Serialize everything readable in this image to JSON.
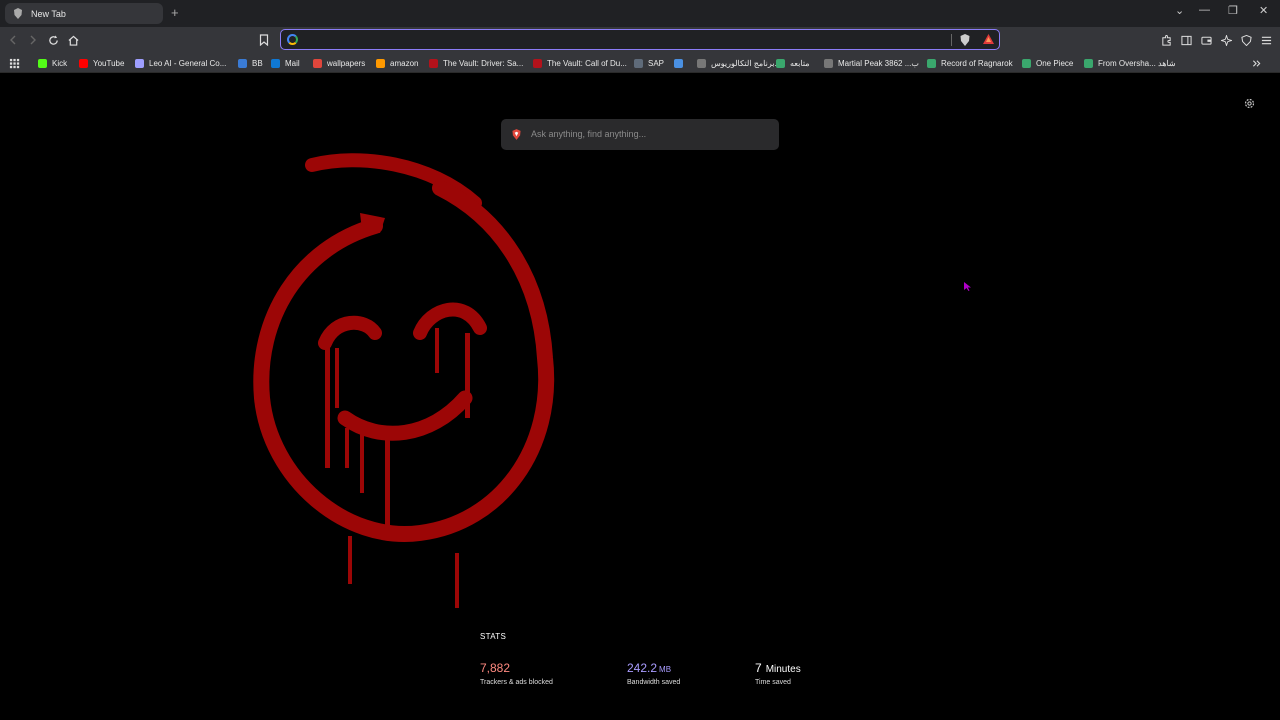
{
  "tab": {
    "title": "New Tab",
    "new_tab_symbol": "+"
  },
  "window_controls": {
    "dropdown": "⌄",
    "minimize": "—",
    "maximize": "❐",
    "close": "✕"
  },
  "toolbar": {
    "url_value": ""
  },
  "bookmarks": [
    {
      "label": "Kick",
      "color": "#53fc18"
    },
    {
      "label": "YouTube",
      "color": "#ff0000"
    },
    {
      "label": "Leo AI - General Co...",
      "color": "#9e9eff"
    },
    {
      "label": "BB",
      "color": "#3a7bd5"
    },
    {
      "label": "Mail",
      "color": "#0f78d4"
    },
    {
      "label": "wallpapers",
      "color": "#e0463c"
    },
    {
      "label": "amazon",
      "color": "#ff9900"
    },
    {
      "label": "The Vault: Driver: Sa...",
      "color": "#b3121b"
    },
    {
      "label": "The Vault: Call of Du...",
      "color": "#b3121b"
    },
    {
      "label": "SAP",
      "color": "#5f6b7a"
    },
    {
      "label": "",
      "color": "#4a90e2"
    },
    {
      "label": "برنامج التكالوريوس...",
      "color": "#777777"
    },
    {
      "label": "متابعه",
      "color": "#3aa76d"
    },
    {
      "label": "Martial Peak 3862 ...ب",
      "color": "#777777"
    },
    {
      "label": "Record of Ragnarok",
      "color": "#3aa76d"
    },
    {
      "label": "One Piece",
      "color": "#3aa76d"
    },
    {
      "label": "From Oversha... شاهد",
      "color": "#3aa76d"
    }
  ],
  "search": {
    "placeholder": "Ask anything, find anything..."
  },
  "stats": {
    "label": "STATS",
    "trackers": {
      "value": "7,882",
      "desc": "Trackers & ads blocked",
      "color": "#ff8a80"
    },
    "bandwidth": {
      "value": "242.2",
      "unit": "MB",
      "desc": "Bandwidth saved",
      "color": "#a99cff"
    },
    "time": {
      "value": "7",
      "unit": "Minutes",
      "desc": "Time saved",
      "color": "#ffffff"
    }
  }
}
